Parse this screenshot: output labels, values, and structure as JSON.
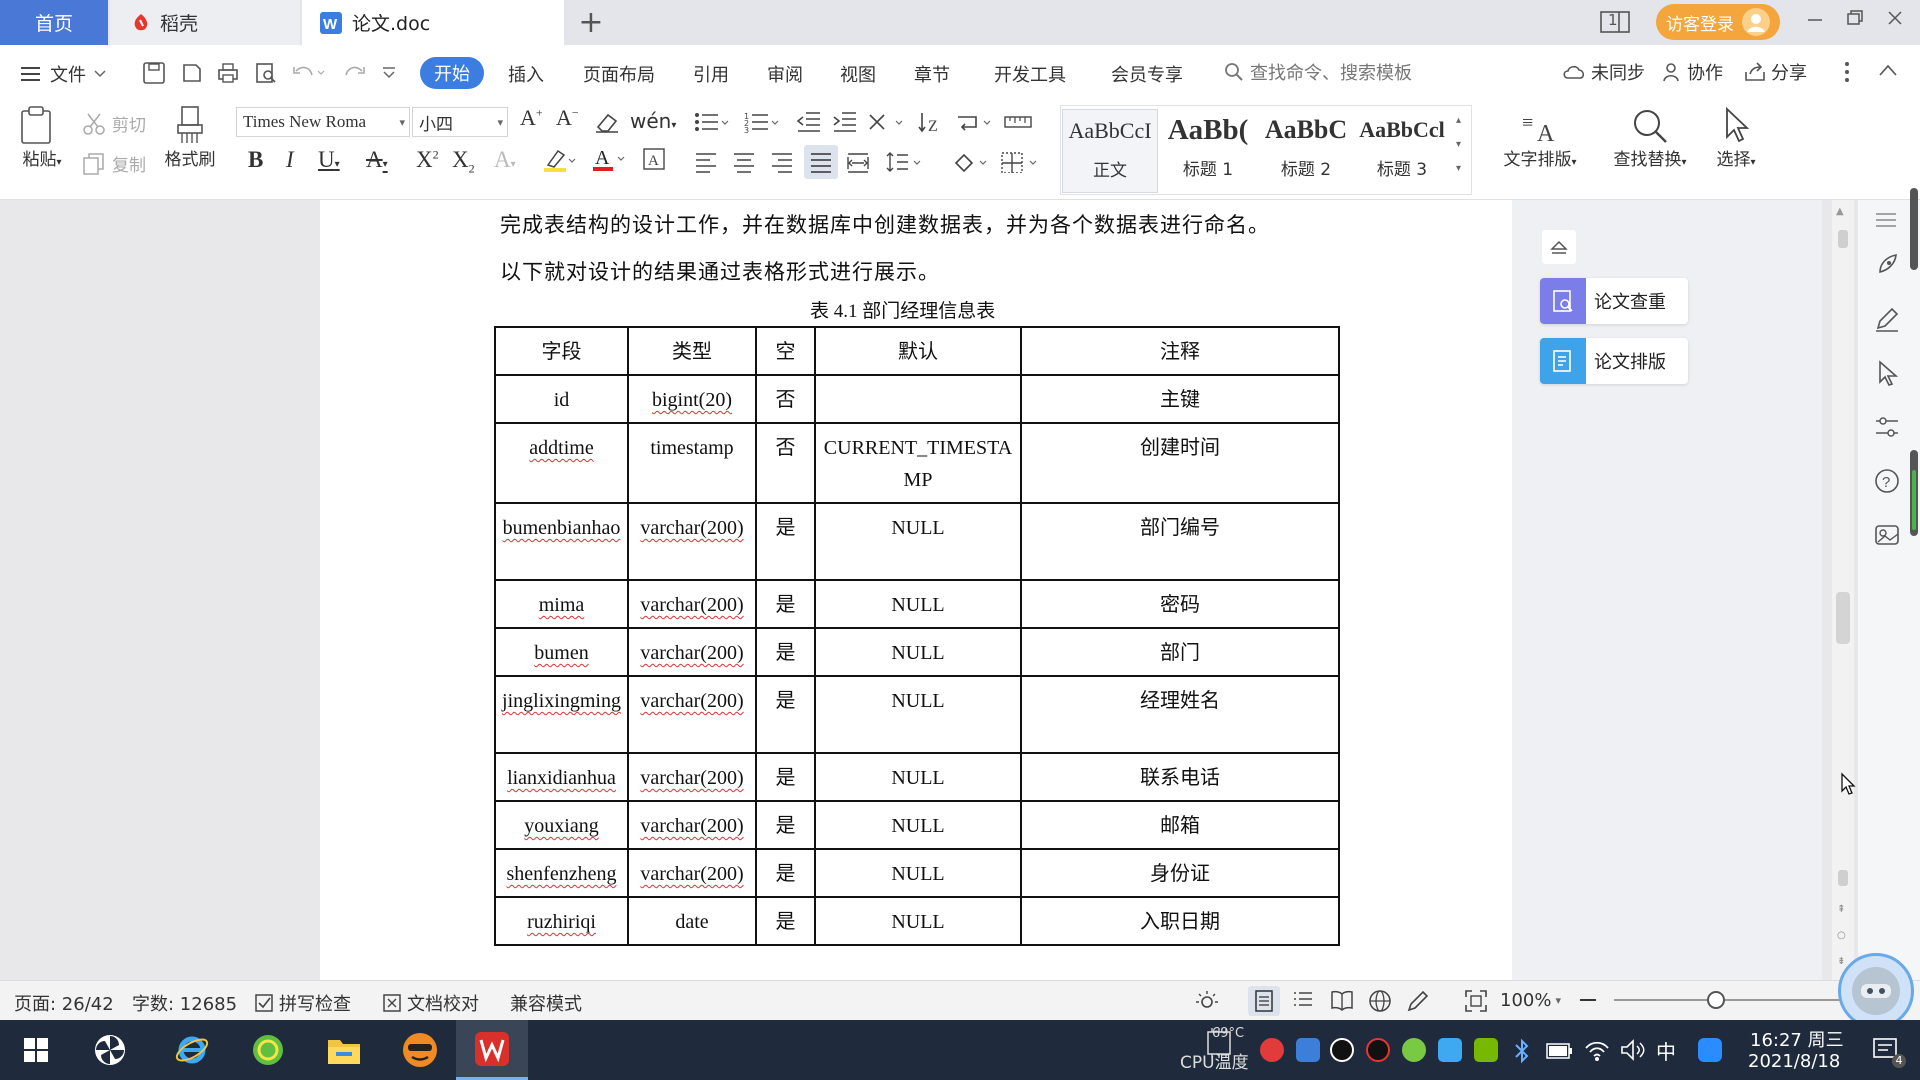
{
  "tabs": {
    "home": "首页",
    "daoke": "稻壳",
    "doc": "论文.doc",
    "add": "+"
  },
  "window": {
    "visitor_login": "访客登录",
    "page_badge": "1"
  },
  "menu": {
    "file": "文件",
    "items": [
      "开始",
      "插入",
      "页面布局",
      "引用",
      "审阅",
      "视图",
      "章节",
      "开发工具",
      "会员专享"
    ],
    "search_placeholder": "查找命令、搜索模板",
    "unsynced": "未同步",
    "collab": "协作",
    "share": "分享"
  },
  "ribbon": {
    "paste": "粘贴",
    "cut": "剪切",
    "copy": "复制",
    "format_painter": "格式刷",
    "font_name": "Times New Roma",
    "font_size": "小四",
    "styles": [
      {
        "sample": "AaBbCcI",
        "name": "正文"
      },
      {
        "sample": "AaBb(",
        "name": "标题 1"
      },
      {
        "sample": "AaBbC",
        "name": "标题 2"
      },
      {
        "sample": "AaBbCcl",
        "name": "标题 3"
      }
    ],
    "text_layout": "文字排版",
    "find_replace": "查找替换",
    "select": "选择"
  },
  "document": {
    "para1": "完成表结构的设计工作，并在数据库中创建数据表，并为各个数据表进行命名。",
    "para2": "以下就对设计的结果通过表格形式进行展示。",
    "caption": "表 4.1  部门经理信息表",
    "table": {
      "headers": [
        "字段",
        "类型",
        "空",
        "默认",
        "注释"
      ],
      "rows": [
        [
          "id",
          "bigint(20)",
          "否",
          "",
          "主键"
        ],
        [
          "addtime",
          "timestamp",
          "否",
          "CURRENT_TIMESTAMP",
          "创建时间"
        ],
        [
          "bumenbianhao",
          "varchar(200)",
          "是",
          "NULL",
          "部门编号"
        ],
        [
          "mima",
          "varchar(200)",
          "是",
          "NULL",
          "密码"
        ],
        [
          "bumen",
          "varchar(200)",
          "是",
          "NULL",
          "部门"
        ],
        [
          "jinglixingming",
          "varchar(200)",
          "是",
          "NULL",
          "经理姓名"
        ],
        [
          "lianxidianhua",
          "varchar(200)",
          "是",
          "NULL",
          "联系电话"
        ],
        [
          "youxiang",
          "varchar(200)",
          "是",
          "NULL",
          "邮箱"
        ],
        [
          "shenfenzheng",
          "varchar(200)",
          "是",
          "NULL",
          "身份证"
        ],
        [
          "ruzhiriqi",
          "date",
          "是",
          "NULL",
          "入职日期"
        ]
      ]
    }
  },
  "side_panel": {
    "check": "论文查重",
    "layout": "论文排版"
  },
  "status": {
    "page": "页面: 26/42",
    "words": "字数: 12685",
    "spell": "拼写检查",
    "proof": "文档校对",
    "compat": "兼容模式",
    "zoom": "100%"
  },
  "taskbar": {
    "cpu_temp": "69°C",
    "cpu_label": "CPU温度",
    "ime": "中",
    "time": "16:27 周三",
    "date": "2021/8/18",
    "notif_count": "4"
  },
  "colors": {
    "accent": "#3b7de0",
    "home_tab": "#4a78d6",
    "visitor": "#f4a53c",
    "taskbar": "#1f2a3d"
  }
}
